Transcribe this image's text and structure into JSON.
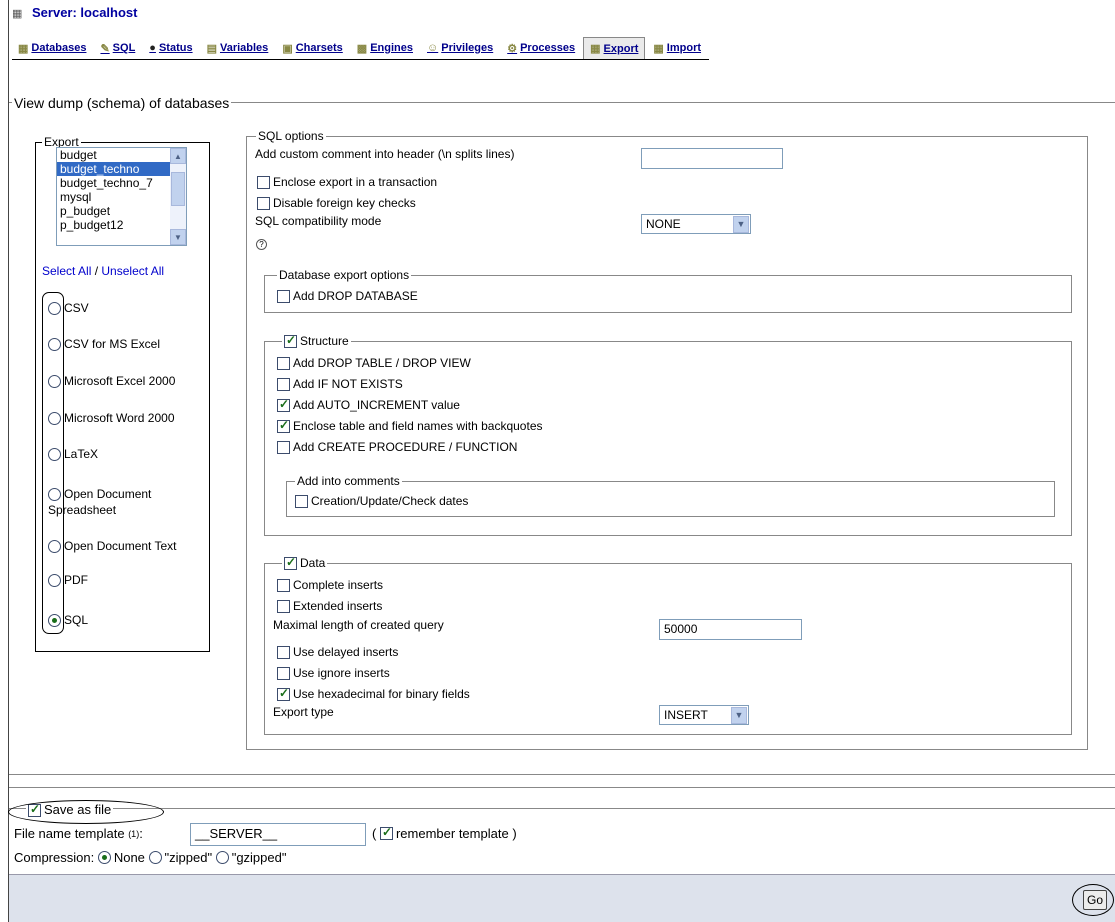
{
  "server_title": "Server: localhost",
  "tabs": [
    {
      "label": "Databases",
      "icon": "databases-icon"
    },
    {
      "label": "SQL",
      "icon": "sql-icon"
    },
    {
      "label": "Status",
      "icon": "status-icon"
    },
    {
      "label": "Variables",
      "icon": "variables-icon"
    },
    {
      "label": "Charsets",
      "icon": "charsets-icon"
    },
    {
      "label": "Engines",
      "icon": "engines-icon"
    },
    {
      "label": "Privileges",
      "icon": "privileges-icon"
    },
    {
      "label": "Processes",
      "icon": "processes-icon"
    },
    {
      "label": "Export",
      "icon": "export-icon",
      "active": true
    },
    {
      "label": "Import",
      "icon": "import-icon"
    }
  ],
  "main_legend": "View dump (schema) of databases",
  "export_panel": {
    "legend": "Export",
    "databases": [
      "budget",
      "budget_techno",
      "budget_techno_7",
      "mysql",
      "p_budget",
      "p_budget12"
    ],
    "selected_database": "budget_techno",
    "select_all": "Select All",
    "separator": "/",
    "unselect_all": "Unselect All",
    "formats": [
      "CSV",
      "CSV for MS Excel",
      "Microsoft Excel 2000",
      "Microsoft Word 2000",
      "LaTeX",
      "Open Document Spreadsheet",
      "Open Document Text",
      "PDF",
      "SQL"
    ],
    "selected_format": "SQL"
  },
  "sql_options": {
    "legend": "SQL options",
    "custom_comment_label": "Add custom comment into header (\\n splits lines)",
    "custom_comment_value": "",
    "enclose_transaction": "Enclose export in a transaction",
    "disable_fk": "Disable foreign key checks",
    "compat_label": "SQL compatibility mode",
    "compat_value": "NONE",
    "help": "?"
  },
  "db_export_options": {
    "legend": "Database export options",
    "drop_database": "Add DROP DATABASE"
  },
  "structure": {
    "legend": "Structure",
    "drop_table": "Add DROP TABLE / DROP VIEW",
    "if_not_exists": "Add IF NOT EXISTS",
    "auto_increment": "Add AUTO_INCREMENT value",
    "backquotes": "Enclose table and field names with backquotes",
    "create_procedure": "Add CREATE PROCEDURE / FUNCTION",
    "comments_legend": "Add into comments",
    "creation_dates": "Creation/Update/Check dates"
  },
  "data": {
    "legend": "Data",
    "complete_inserts": "Complete inserts",
    "extended_inserts": "Extended inserts",
    "max_query_label": "Maximal length of created query",
    "max_query_value": "50000",
    "delayed_inserts": "Use delayed inserts",
    "ignore_inserts": "Use ignore inserts",
    "hexadecimal": "Use hexadecimal for binary fields",
    "export_type_label": "Export type",
    "export_type_value": "INSERT"
  },
  "save": {
    "legend": "Save as file",
    "file_template_label": "File name template",
    "footnote": "(1)",
    "colon": ":",
    "file_template_value": "__SERVER__",
    "open_paren": "(",
    "remember_template": "remember template",
    "close_paren": ")",
    "compression_label": "Compression:",
    "compression_none": "None",
    "compression_zipped": "\"zipped\"",
    "compression_gzipped": "\"gzipped\""
  },
  "go_button": "Go"
}
